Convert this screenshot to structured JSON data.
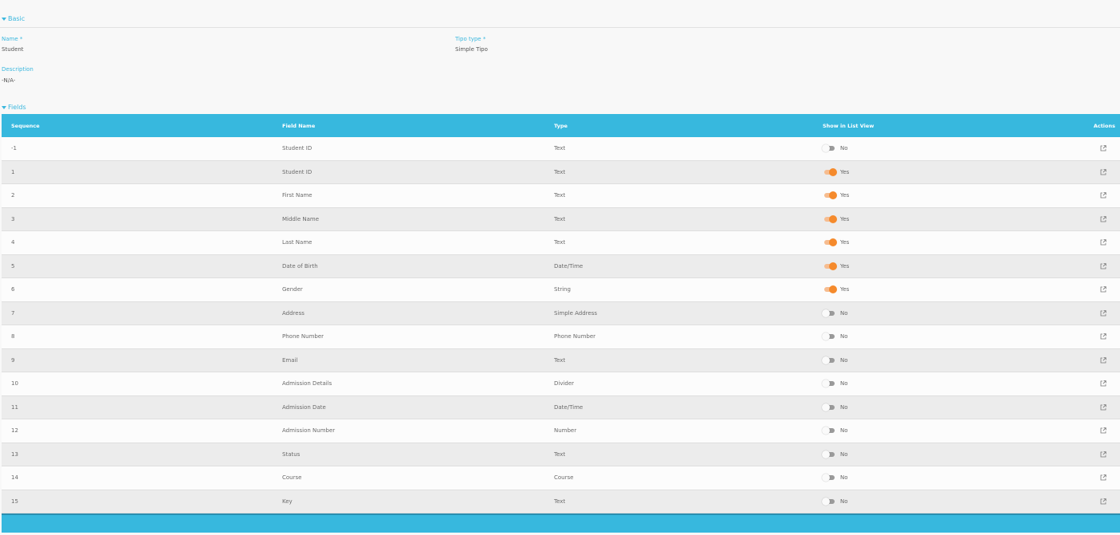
{
  "basic": {
    "header": "Basic",
    "name_label": "Name *",
    "name_value": "Student",
    "tipo_type_label": "Tipo type *",
    "tipo_type_value": "Simple Tipo",
    "description_label": "Description",
    "description_value": "-N/A-"
  },
  "fields": {
    "header": "Fields",
    "columns": {
      "sequence": "Sequence",
      "field_name": "Field Name",
      "type": "Type",
      "show_in_list_view": "Show in List View",
      "actions": "Actions"
    },
    "rows": [
      {
        "sequence": "-1",
        "field_name": "Student ID",
        "type": "Text",
        "show": false,
        "show_label": "No"
      },
      {
        "sequence": "1",
        "field_name": "Student ID",
        "type": "Text",
        "show": true,
        "show_label": "Yes"
      },
      {
        "sequence": "2",
        "field_name": "First Name",
        "type": "Text",
        "show": true,
        "show_label": "Yes"
      },
      {
        "sequence": "3",
        "field_name": "Middle Name",
        "type": "Text",
        "show": true,
        "show_label": "Yes"
      },
      {
        "sequence": "4",
        "field_name": "Last Name",
        "type": "Text",
        "show": true,
        "show_label": "Yes"
      },
      {
        "sequence": "5",
        "field_name": "Date of Birth",
        "type": "Date/Time",
        "show": true,
        "show_label": "Yes"
      },
      {
        "sequence": "6",
        "field_name": "Gender",
        "type": "String",
        "show": true,
        "show_label": "Yes"
      },
      {
        "sequence": "7",
        "field_name": "Address",
        "type": "Simple Address",
        "show": false,
        "show_label": "No"
      },
      {
        "sequence": "8",
        "field_name": "Phone Number",
        "type": "Phone Number",
        "show": false,
        "show_label": "No"
      },
      {
        "sequence": "9",
        "field_name": "Email",
        "type": "Text",
        "show": false,
        "show_label": "No"
      },
      {
        "sequence": "10",
        "field_name": "Admission Details",
        "type": "Divider",
        "show": false,
        "show_label": "No"
      },
      {
        "sequence": "11",
        "field_name": "Admission Date",
        "type": "Date/Time",
        "show": false,
        "show_label": "No"
      },
      {
        "sequence": "12",
        "field_name": "Admission Number",
        "type": "Number",
        "show": false,
        "show_label": "No"
      },
      {
        "sequence": "13",
        "field_name": "Status",
        "type": "Text",
        "show": false,
        "show_label": "No"
      },
      {
        "sequence": "14",
        "field_name": "Course",
        "type": "Course",
        "show": false,
        "show_label": "No"
      },
      {
        "sequence": "15",
        "field_name": "Key",
        "type": "Text",
        "show": false,
        "show_label": "No"
      }
    ],
    "action_icon": "external-link-icon"
  },
  "colors": {
    "accent": "#37b8de",
    "toggle_on": "#f58a2c",
    "toggle_on_track": "#f6bc8f",
    "toggle_off_track": "#9a9a9a"
  }
}
